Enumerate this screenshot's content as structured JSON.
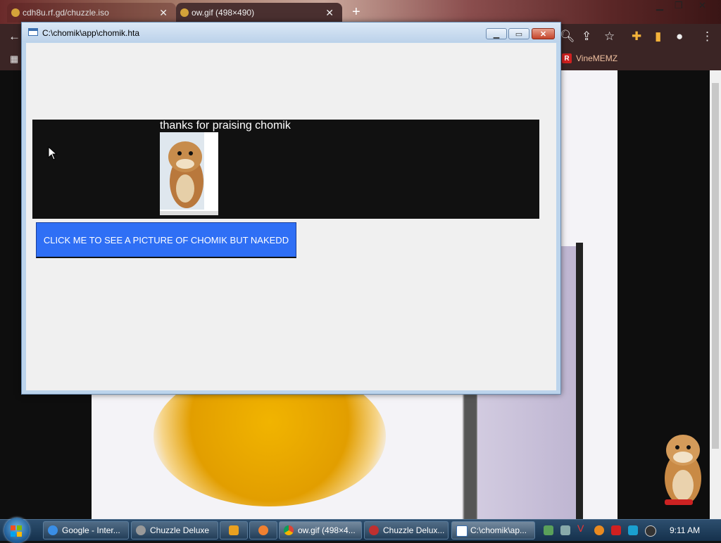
{
  "browser": {
    "tabs": [
      {
        "label": "cdh8u.rf.gd/chuzzle.iso"
      },
      {
        "label": "ow.gif (498×490)"
      }
    ],
    "bookmark": {
      "label": "VineMEMZ"
    }
  },
  "hta": {
    "title": "C:\\chomik\\app\\chomik.hta",
    "banner_text": "thanks for praising chomik",
    "button_label": "CLICK ME TO SEE A PICTURE OF CHOMIK BUT NAKEDD"
  },
  "taskbar": {
    "items": [
      {
        "label": "Google - Inter..."
      },
      {
        "label": "Chuzzle Deluxe"
      },
      {
        "label": "ow.gif (498×4..."
      },
      {
        "label": "Chuzzle Delux..."
      },
      {
        "label": "C:\\chomik\\ap..."
      }
    ],
    "clock": "9:11 AM"
  }
}
